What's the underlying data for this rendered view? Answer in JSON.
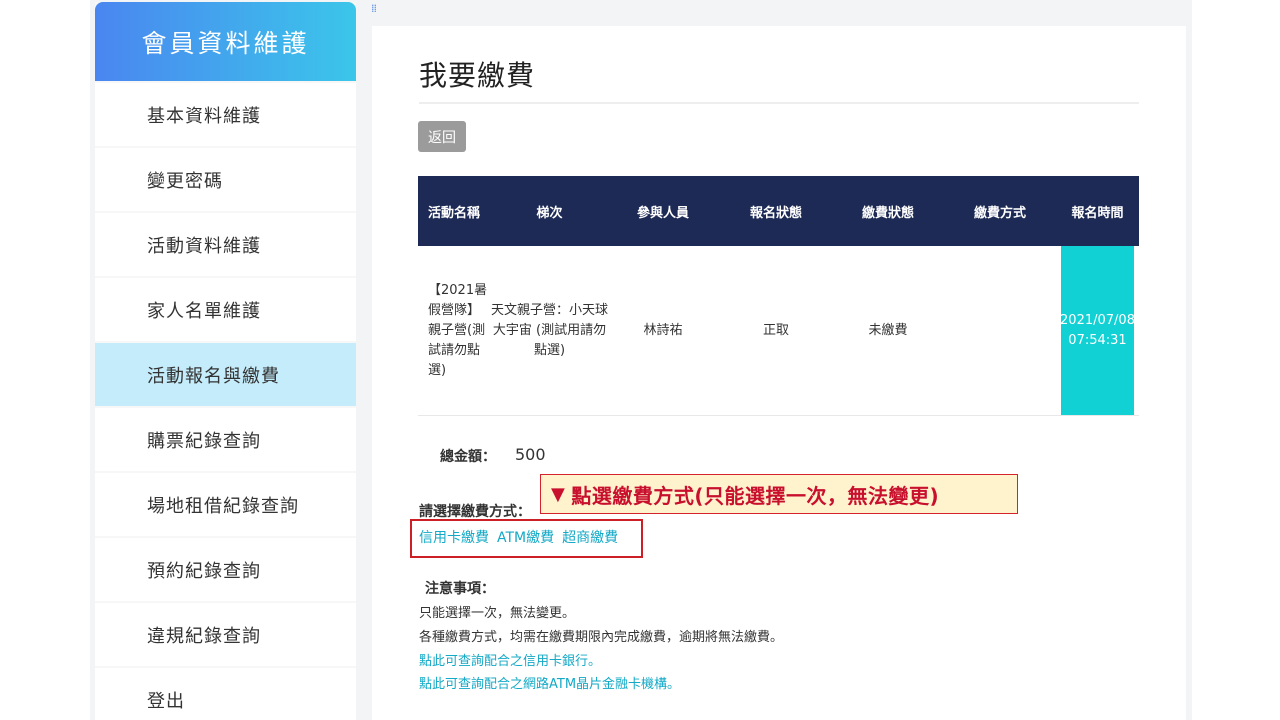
{
  "sidebar": {
    "title": "會員資料維護",
    "items": [
      {
        "label": "基本資料維護"
      },
      {
        "label": "變更密碼"
      },
      {
        "label": "活動資料維護"
      },
      {
        "label": "家人名單維護"
      },
      {
        "label": "活動報名與繳費"
      },
      {
        "label": "購票紀錄查詢"
      },
      {
        "label": "場地租借紀錄查詢"
      },
      {
        "label": "預約紀錄查詢"
      },
      {
        "label": "違規紀錄查詢"
      },
      {
        "label": "登出"
      }
    ],
    "active_index": 4
  },
  "main": {
    "title": "我要繳費",
    "back_label": "返回",
    "table": {
      "headers": [
        "活動名稱",
        "梯次",
        "參與人員",
        "報名狀態",
        "繳費狀態",
        "繳費方式",
        "報名時間"
      ],
      "row": {
        "activity": "【2021暑假營隊】親子營(測試請勿點選)",
        "session": "天文親子營：小天球大宇宙 (測試用請勿點選)",
        "participant": "林詩祐",
        "signup_status": "正取",
        "payment_status": "未繳費",
        "payment_method": "",
        "signup_time": "2021/07/08 07:54:31"
      }
    },
    "total_label": "總金額：",
    "total_value": "500",
    "annotation": "點選繳費方式(只能選擇一次，無法變更)",
    "payment_label": "請選擇繳費方式：",
    "payment_options": [
      "信用卡繳費",
      "ATM繳費",
      "超商繳費"
    ],
    "notes_title": "注意事項：",
    "notes": [
      "只能選擇一次，無法變更。",
      "各種繳費方式，均需在繳費期限內完成繳費，逾期將無法繳費。"
    ],
    "note_links": [
      "點此可查詢配合之信用卡銀行。",
      "點此可查詢配合之網路ATM晶片金融卡機構。"
    ]
  },
  "colors": {
    "header_gradient_start": "#4a86f0",
    "header_gradient_end": "#3bc6ea",
    "active_item": "#c4ecfa",
    "table_head": "#1d2a55",
    "time_cell": "#12d1d4",
    "link": "#14a9c6",
    "annotation_red": "#c8102e"
  }
}
